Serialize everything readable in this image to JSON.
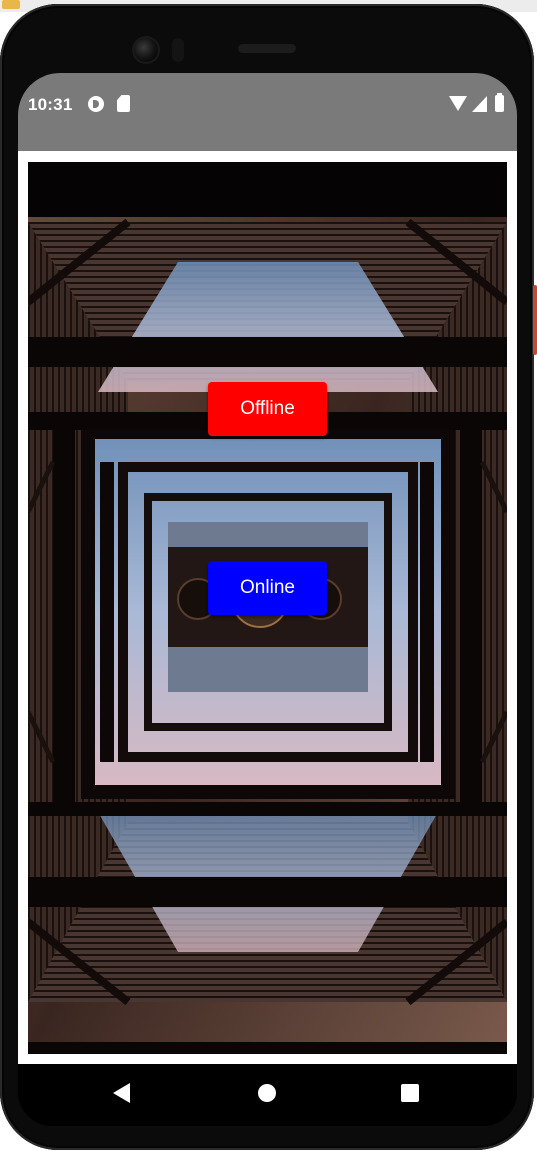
{
  "status_bar": {
    "time": "10:31",
    "icons": [
      "data-saver-icon",
      "sd-card-icon",
      "wifi-icon",
      "cell-signal-icon",
      "battery-icon"
    ],
    "background_color": "#7a7a7a"
  },
  "main": {
    "background_image": "overhead steel structure",
    "offline_button": {
      "label": "Offline",
      "color": "#ff0000"
    },
    "online_button": {
      "label": "Online",
      "color": "#0000ff"
    }
  },
  "nav_bar": {
    "icons": [
      "back-icon",
      "home-icon",
      "recents-icon"
    ]
  }
}
